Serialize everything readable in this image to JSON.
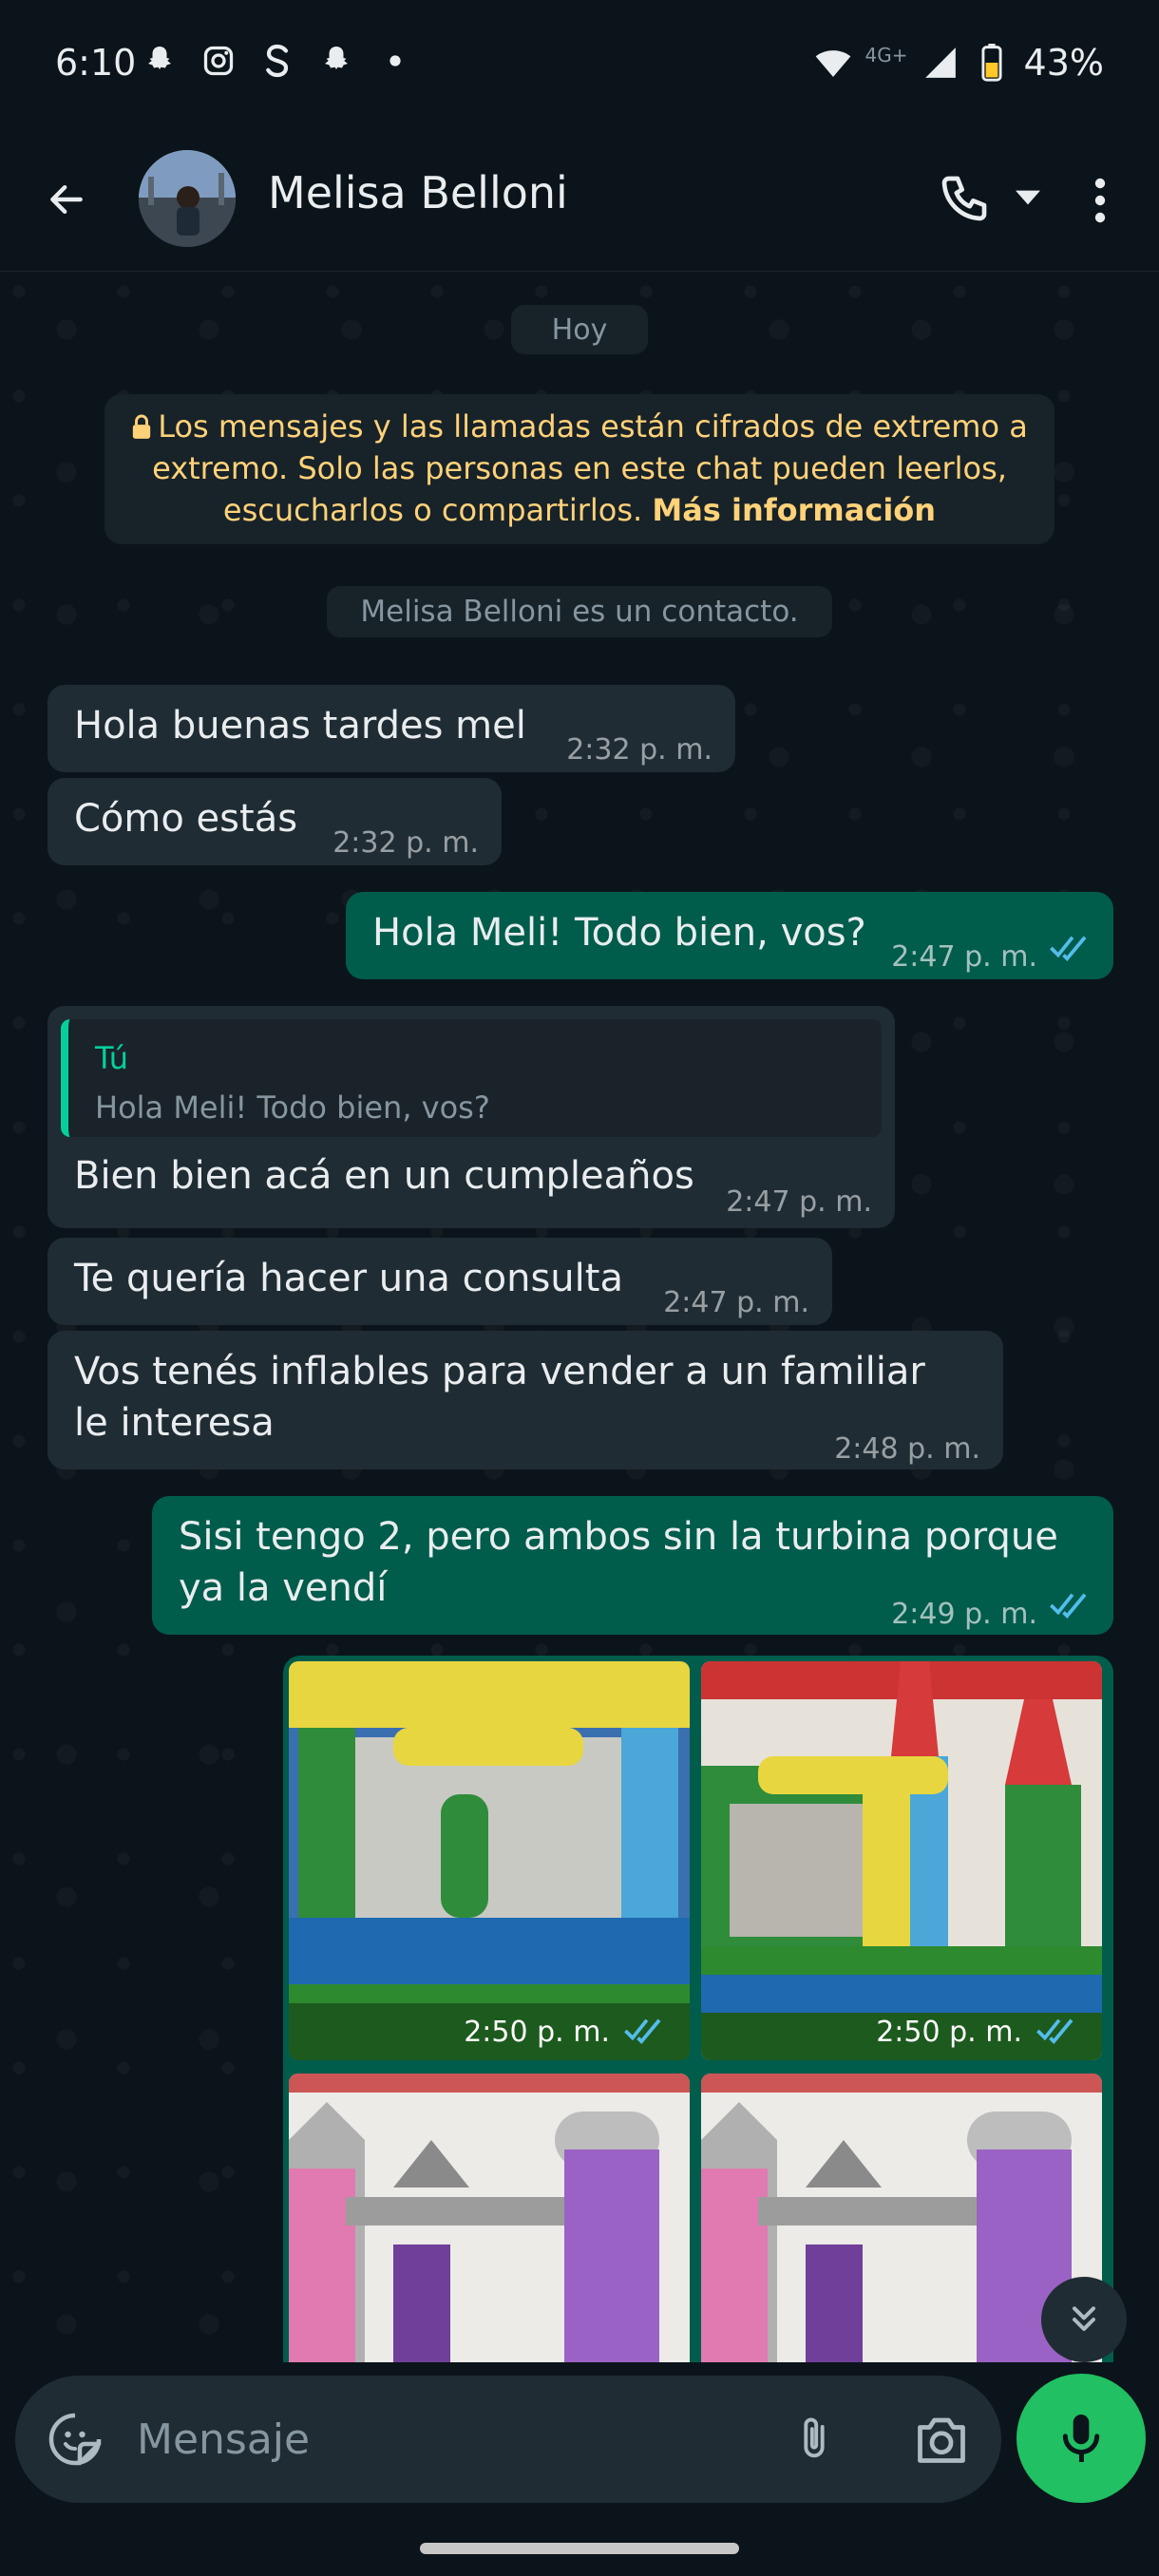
{
  "status_bar": {
    "time": "6:10",
    "network": "4G+",
    "battery": "43%"
  },
  "header": {
    "contact_name": "Melisa Belloni"
  },
  "chat": {
    "date_chip": "Hoy",
    "encryption_notice": {
      "text": "Los mensajes y las llamadas están cifrados de extremo a extremo. Solo las personas en este chat pueden leerlos, escucharlos o compartirlos.",
      "link": "Más información"
    },
    "contact_chip": "Melisa Belloni es un contacto.",
    "messages": [
      {
        "direction": "in",
        "text": "Hola buenas tardes mel",
        "time": "2:32 p. m."
      },
      {
        "direction": "in",
        "text": "Cómo estás",
        "time": "2:32 p. m."
      },
      {
        "direction": "out",
        "text": "Hola Meli! Todo bien, vos?",
        "time": "2:47 p. m.",
        "status": "read"
      },
      {
        "direction": "in",
        "quote": {
          "author": "Tú",
          "text": "Hola Meli! Todo bien, vos?"
        },
        "text": "Bien bien acá en un cumpleaños",
        "time": "2:47 p. m."
      },
      {
        "direction": "in",
        "text": "Te quería hacer una consulta",
        "time": "2:47 p. m."
      },
      {
        "direction": "in",
        "text_line1": "Vos tenés inflables para vender a un familiar",
        "text_line2": "le interesa",
        "time": "2:48 p. m."
      },
      {
        "direction": "out",
        "text_line1": "Sisi tengo 2, pero ambos sin la turbina porque",
        "text_line2": "ya la vendí",
        "time": "2:49 p. m.",
        "status": "read"
      }
    ],
    "images": [
      {
        "time": "2:50 p. m.",
        "status": "read"
      },
      {
        "time": "2:50 p. m.",
        "status": "read"
      },
      {
        "time": "",
        "status": ""
      },
      {
        "time": "",
        "status": ""
      }
    ]
  },
  "composer": {
    "placeholder": "Mensaje"
  },
  "colors": {
    "incoming_bubble": "#202c33",
    "outgoing_bubble": "#005c4b",
    "accent_green": "#21c063",
    "read_ticks": "#53bdeb"
  }
}
